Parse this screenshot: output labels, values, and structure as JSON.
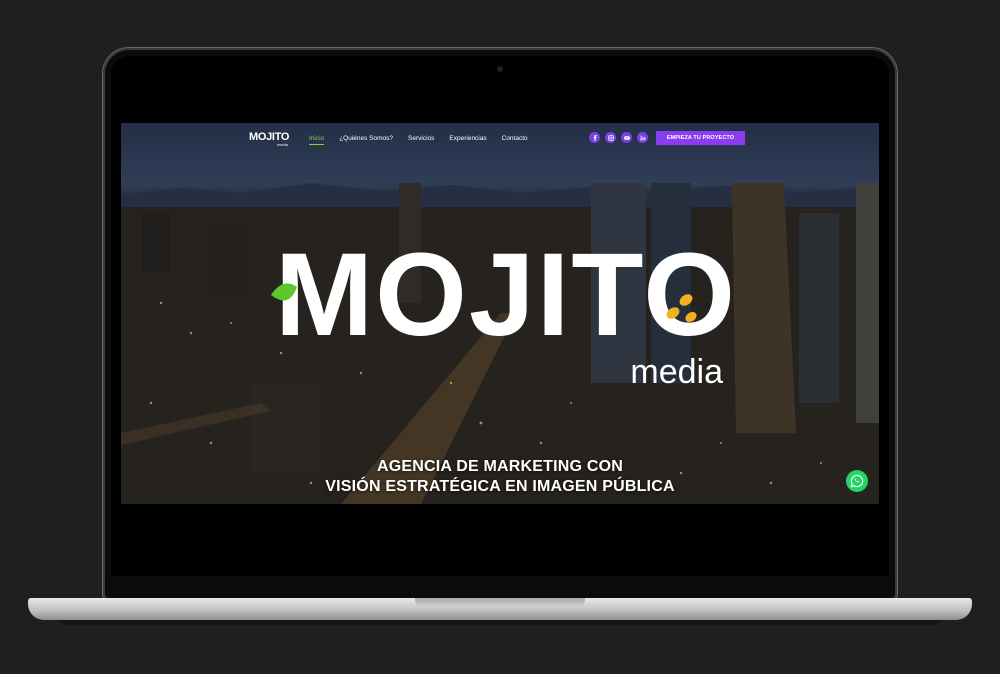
{
  "brand": {
    "nav_logo": "MOJITO",
    "nav_logo_sub": "media",
    "hero_logo": "MOJITO",
    "hero_logo_sub": "media",
    "accent_green": "#7cd64b",
    "accent_purple": "#8a3cf0"
  },
  "nav": {
    "links": [
      {
        "label": "Inicio",
        "active": true
      },
      {
        "label": "¿Quiénes Somos?",
        "active": false
      },
      {
        "label": "Servicios",
        "active": false
      },
      {
        "label": "Experiencias",
        "active": false
      },
      {
        "label": "Contacto",
        "active": false
      }
    ],
    "socials": [
      "facebook-icon",
      "instagram-icon",
      "youtube-icon",
      "linkedin-icon"
    ],
    "cta_label": "EMPIEZA TU PROYECTO"
  },
  "hero": {
    "tagline_line1": "AGENCIA DE MARKETING CON",
    "tagline_line2": "VISIÓN ESTRATÉGICA EN IMAGEN PÚBLICA"
  },
  "floating": {
    "whatsapp_icon": "whatsapp-icon"
  }
}
